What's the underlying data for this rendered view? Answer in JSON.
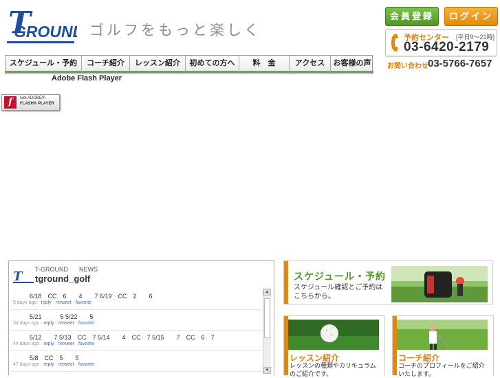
{
  "brand": {
    "logo_text": "T GROUND",
    "tagline": "ゴルフをもっと楽しく"
  },
  "top_buttons": {
    "register": "会員登録",
    "login": "ログイン"
  },
  "contact": {
    "reserve_label": "予約センター",
    "reserve_hours": "[平日9〜21時]",
    "reserve_phone": "03-6420-2179",
    "inquiry_label": "お問い合わせ",
    "inquiry_phone": "03-5766-7657"
  },
  "nav": {
    "items": [
      "スケジュール・予約",
      "コーチ紹介",
      "レッスン紹介",
      "初めての方へ",
      "料　金",
      "アクセス",
      "お客様の声"
    ]
  },
  "flash": {
    "title": "Adobe Flash Player",
    "badge_get": "Get ADOBE®",
    "badge_brand": "FLASH® PLAYER"
  },
  "twitter": {
    "org": "T-GROUND",
    "news_label": "NEWS",
    "username": "tground_golf",
    "actions": [
      "reply",
      "retweet",
      "favorite"
    ],
    "tweets": [
      {
        "text": "6/18　CC　6　　4　　7 6/19　CC　2　　6",
        "age": "9 days ago"
      },
      {
        "text": "5/21　　　5 5/22　　5",
        "age": "34 days ago"
      },
      {
        "text": "5/12　　7 5/13　CC　7 5/14　　4　CC　7 5/15　　7　CC　6　7",
        "age": "44 days ago"
      },
      {
        "text": "5/8　CC　5　　5",
        "age": "47 days ago"
      }
    ]
  },
  "panels": {
    "schedule": {
      "title": "スケジュール・予約",
      "desc": "スケジュール確認とご予約は\nこちらから。"
    },
    "lesson": {
      "title": "レッスン紹介",
      "desc": "レッスンの種類やカリキュラム\nのご紹介です。"
    },
    "coach": {
      "title": "コーチ紹介",
      "desc": "コーチのプロフィールをご紹介\nいたします。"
    }
  },
  "colors": {
    "accent_green": "#4f9a22",
    "accent_orange": "#e8860b",
    "logo_blue": "#1f4f9a"
  }
}
